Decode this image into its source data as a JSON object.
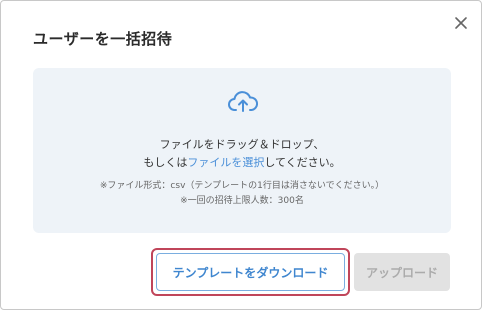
{
  "dialog": {
    "title": "ユーザーを一括招待",
    "close_icon": "close-icon"
  },
  "dropzone": {
    "icon": "cloud-upload-icon",
    "line1": "ファイルをドラッグ＆ドロップ、",
    "line2_prefix": "もしくは",
    "line2_link": "ファイルを選択",
    "line2_suffix": "してください。",
    "note1": "※ファイル形式：csv（テンプレートの1行目は消さないでください。）",
    "note2": "※一回の招待上限人数：300名"
  },
  "buttons": {
    "download_template": "テンプレートをダウンロード",
    "upload": "アップロード"
  },
  "colors": {
    "accent": "#4a8fd8",
    "highlight_border": "#c0455a",
    "dropzone_bg": "#eef3f8",
    "disabled_bg": "#e2e2e2"
  }
}
